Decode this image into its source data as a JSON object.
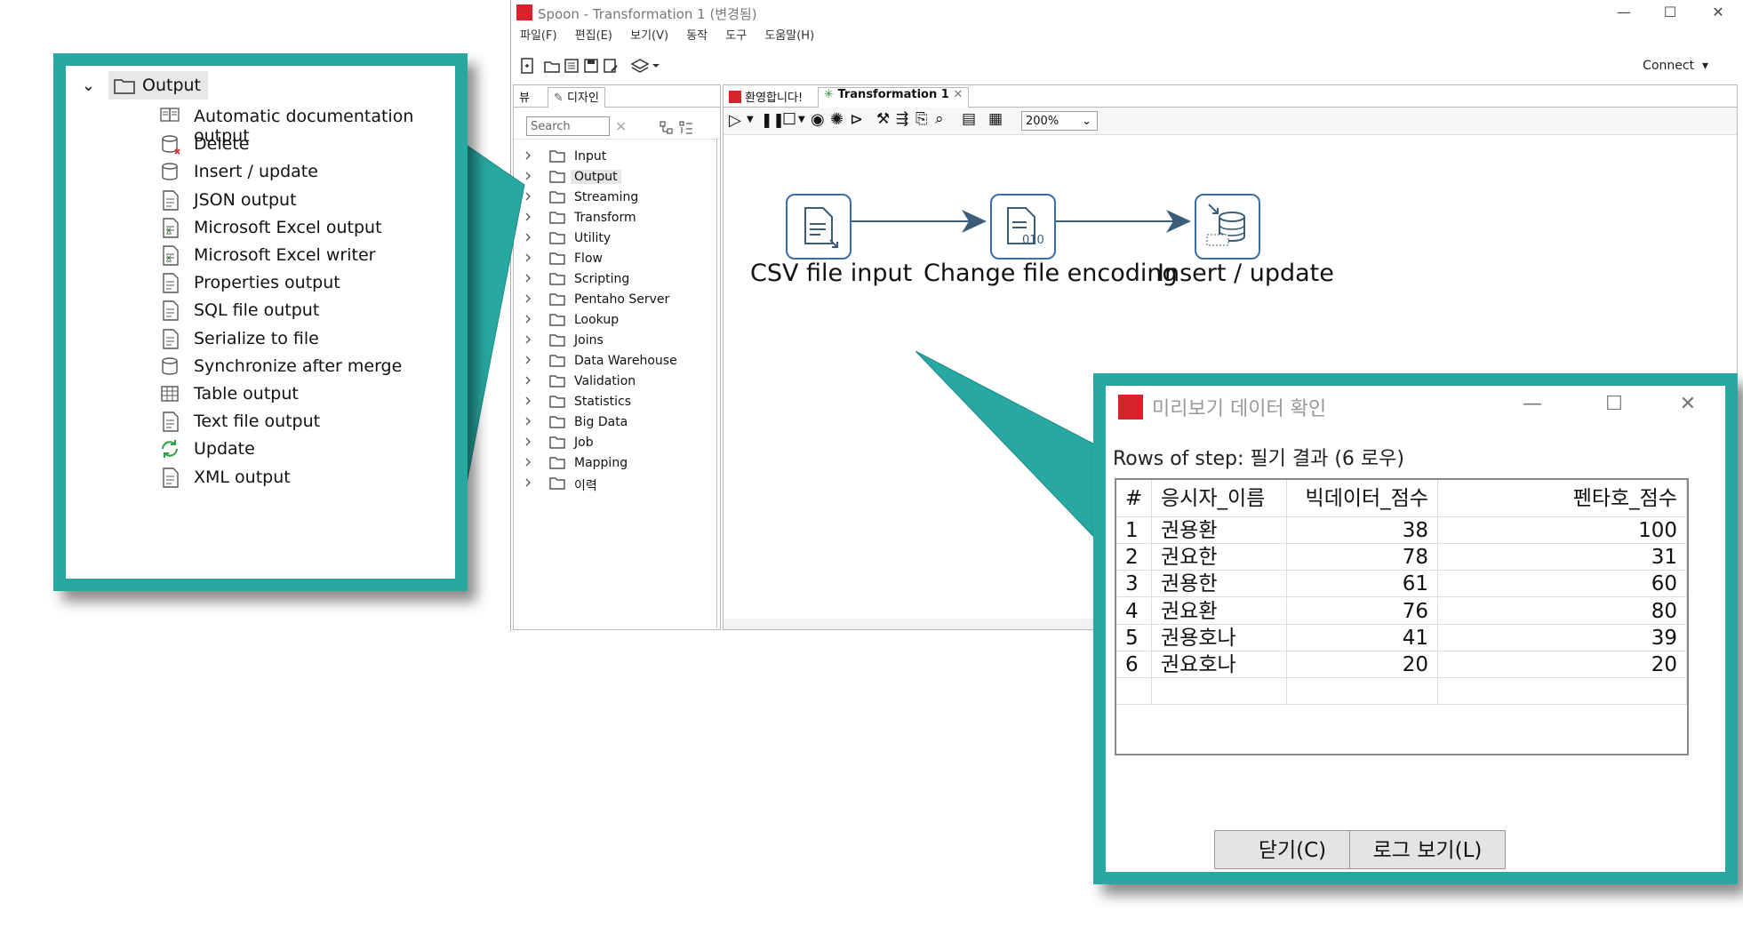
{
  "window": {
    "title": "Spoon - Transformation 1 (변경됨)",
    "controls": {
      "minimize": "—",
      "maximize": "☐",
      "close": "✕"
    }
  },
  "menu": [
    "파일(F)",
    "편집(E)",
    "보기(V)",
    "동작",
    "도구",
    "도움말(H)"
  ],
  "toolbar": {
    "connect_label": "Connect"
  },
  "left_panel": {
    "tabs": [
      "뷰",
      "디자인"
    ],
    "search_placeholder": "Search",
    "tree": [
      {
        "label": "Input",
        "selected": false
      },
      {
        "label": "Output",
        "selected": true
      },
      {
        "label": "Streaming",
        "selected": false
      },
      {
        "label": "Transform",
        "selected": false
      },
      {
        "label": "Utility",
        "selected": false
      },
      {
        "label": "Flow",
        "selected": false
      },
      {
        "label": "Scripting",
        "selected": false
      },
      {
        "label": "Pentaho Server",
        "selected": false
      },
      {
        "label": "Lookup",
        "selected": false
      },
      {
        "label": "Joins",
        "selected": false
      },
      {
        "label": "Data Warehouse",
        "selected": false
      },
      {
        "label": "Validation",
        "selected": false
      },
      {
        "label": "Statistics",
        "selected": false
      },
      {
        "label": "Big Data",
        "selected": false
      },
      {
        "label": "Job",
        "selected": false
      },
      {
        "label": "Mapping",
        "selected": false
      },
      {
        "label": "이력",
        "selected": false
      }
    ]
  },
  "canvas": {
    "tabs": [
      {
        "label": "환영합니다!",
        "active": false
      },
      {
        "label": "Transformation 1",
        "active": true
      }
    ],
    "zoom": "200%",
    "steps": [
      {
        "label": "CSV file input",
        "icon": "csv-file-input-icon"
      },
      {
        "label": "Change file encoding",
        "icon": "change-file-encoding-icon",
        "badge": "010"
      },
      {
        "label": "Insert / update",
        "icon": "insert-update-icon"
      }
    ]
  },
  "output_category": {
    "header": "Output",
    "items": [
      {
        "label": "Automatic documentation output",
        "icon": "auto-doc-icon"
      },
      {
        "label": "Delete",
        "icon": "delete-db-icon"
      },
      {
        "label": "Insert / update",
        "icon": "insert-update-icon"
      },
      {
        "label": "JSON output",
        "icon": "json-output-icon"
      },
      {
        "label": "Microsoft Excel output",
        "icon": "excel-output-icon"
      },
      {
        "label": "Microsoft Excel writer",
        "icon": "excel-writer-icon"
      },
      {
        "label": "Properties output",
        "icon": "properties-output-icon"
      },
      {
        "label": "SQL file output",
        "icon": "sql-file-output-icon"
      },
      {
        "label": "Serialize to file",
        "icon": "serialize-file-icon"
      },
      {
        "label": "Synchronize after merge",
        "icon": "synchronize-icon"
      },
      {
        "label": "Table output",
        "icon": "table-output-icon"
      },
      {
        "label": "Text file output",
        "icon": "text-file-output-icon"
      },
      {
        "label": "Update",
        "icon": "update-icon"
      },
      {
        "label": "XML output",
        "icon": "xml-output-icon"
      }
    ]
  },
  "preview_dialog": {
    "title": "미리보기 데이터 확인",
    "rows_label": "Rows of step: 필기 결과 (6 로우)",
    "columns": [
      "#",
      "응시자_이름",
      "빅데이터_점수",
      "펜타호_점수"
    ],
    "rows": [
      [
        "1",
        "권용환",
        "38",
        "100"
      ],
      [
        "2",
        "권요한",
        "78",
        "31"
      ],
      [
        "3",
        "권용한",
        "61",
        "60"
      ],
      [
        "4",
        "권요환",
        "76",
        "80"
      ],
      [
        "5",
        "권용호나",
        "41",
        "39"
      ],
      [
        "6",
        "권요호나",
        "20",
        "20"
      ]
    ],
    "close_button": "닫기(C)",
    "log_button": "로그 보기(L)"
  },
  "colors": {
    "callout": "#28a8a2",
    "step_border": "#3a6ea5",
    "brand_red": "#d8232a"
  }
}
